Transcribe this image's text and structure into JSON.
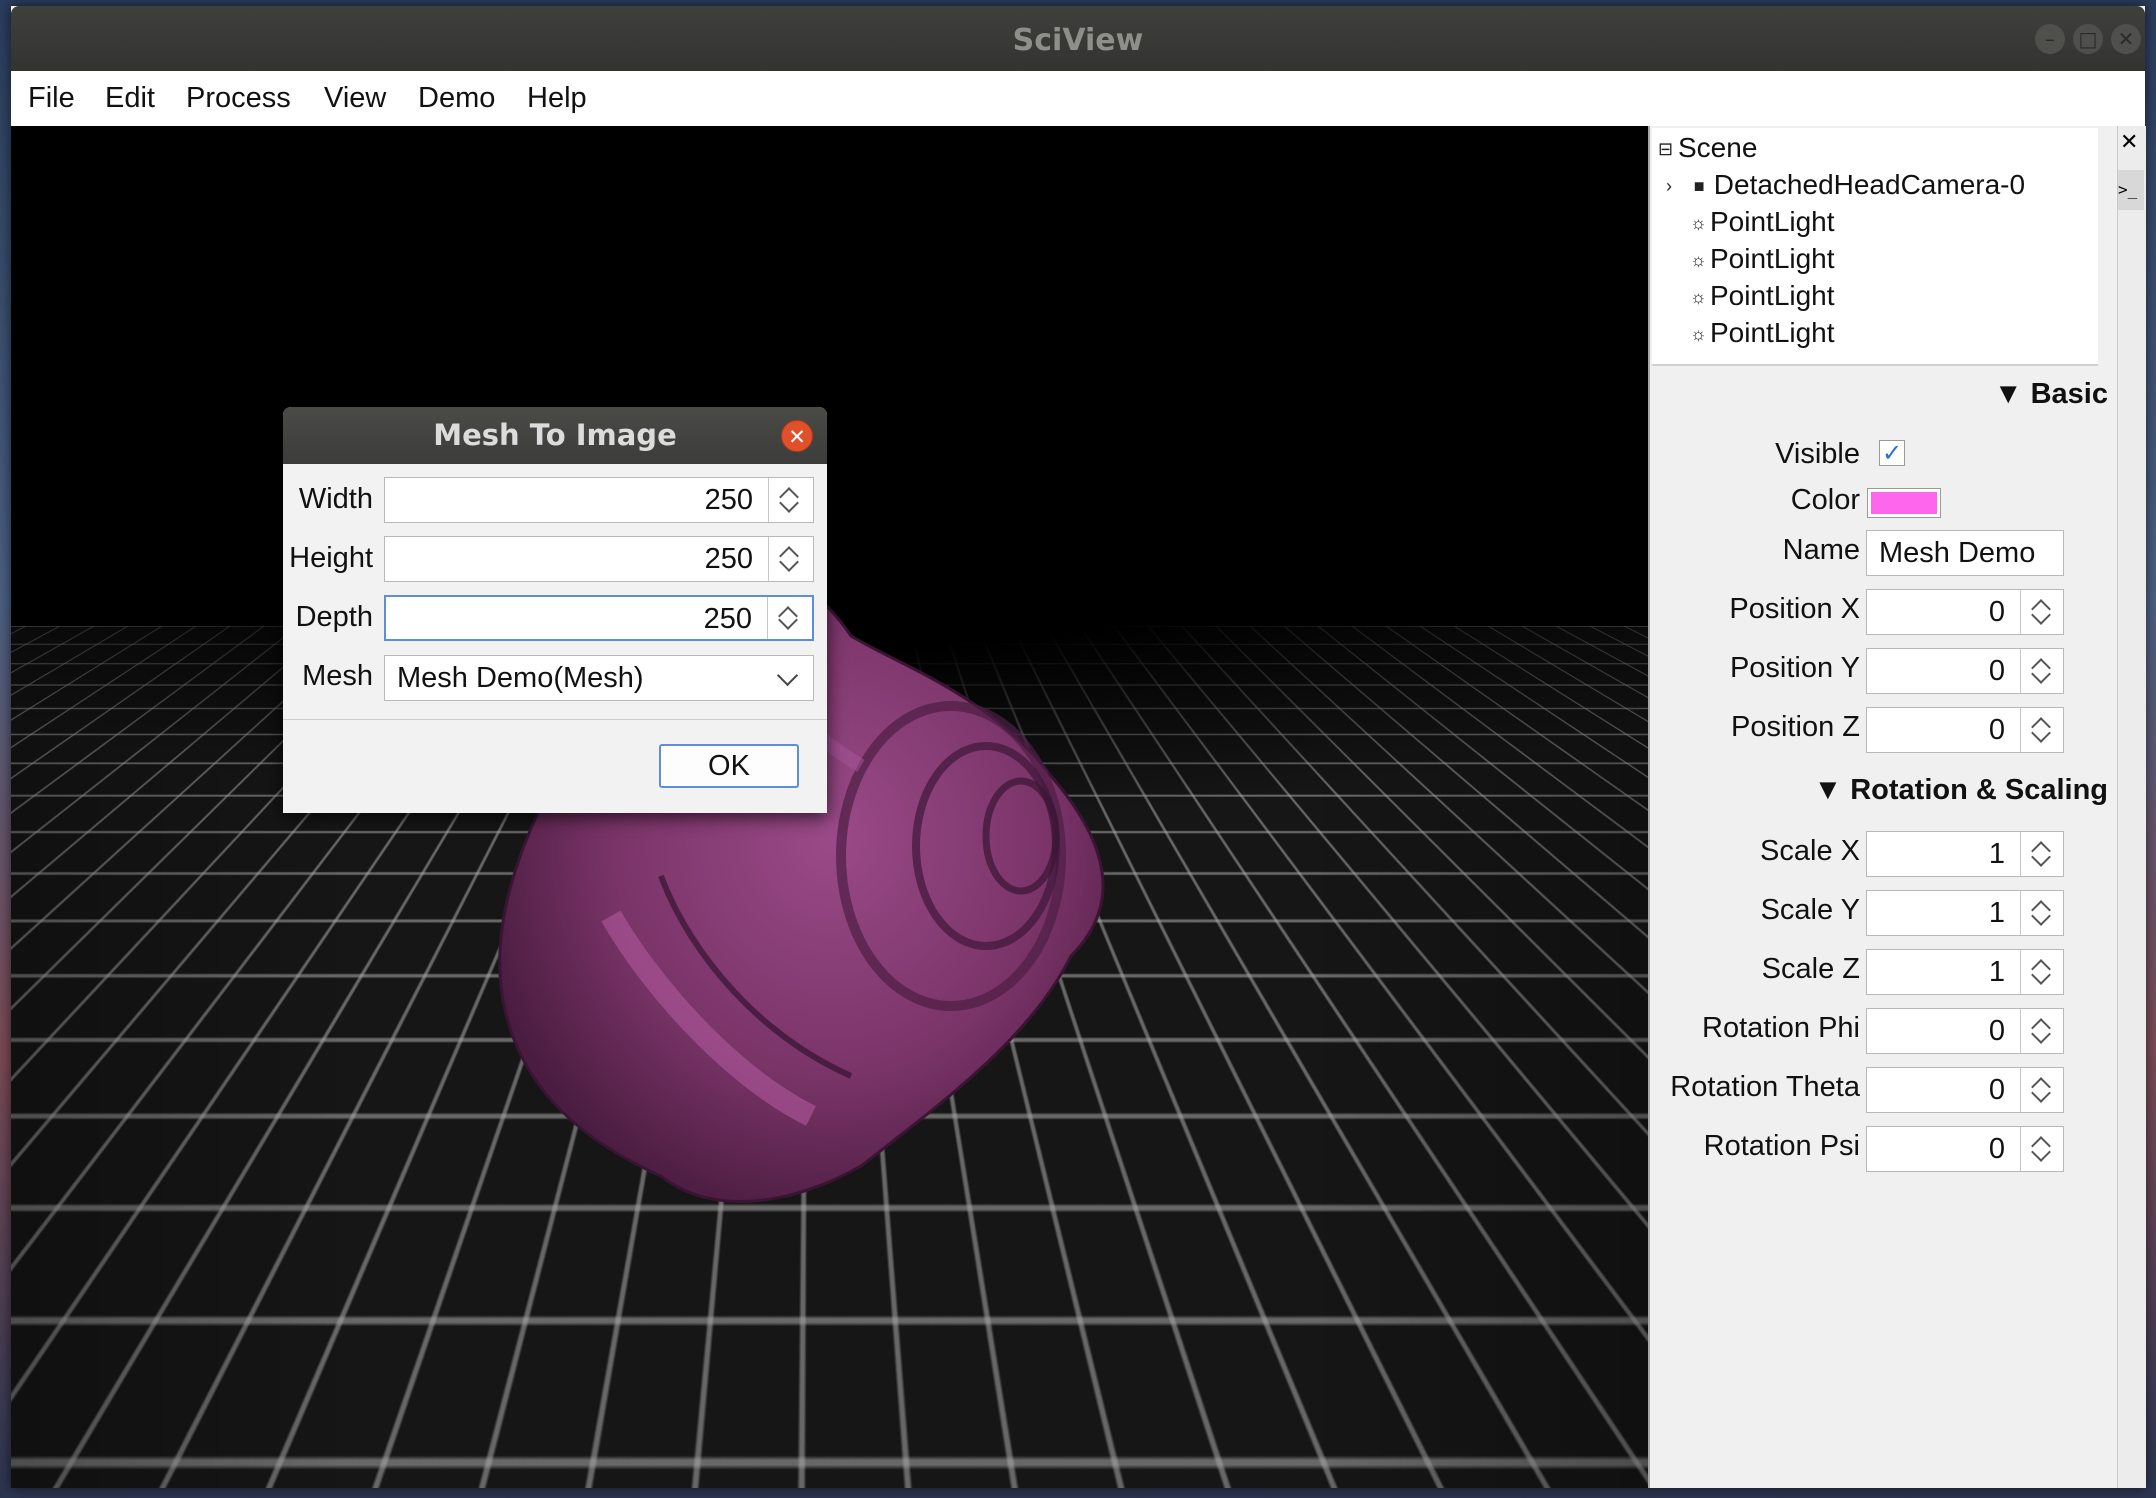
{
  "window": {
    "title": "SciView",
    "controls": [
      "minimize",
      "maximize",
      "close"
    ]
  },
  "menubar": {
    "items": [
      "File",
      "Edit",
      "Process",
      "View",
      "Demo",
      "Help"
    ]
  },
  "viewport": {
    "mesh_color": "#8a3f78",
    "background": "#000000"
  },
  "dialog": {
    "title": "Mesh To Image",
    "fields": [
      {
        "label": "Width",
        "value": "250"
      },
      {
        "label": "Height",
        "value": "250"
      },
      {
        "label": "Depth",
        "value": "250"
      }
    ],
    "mesh": {
      "label": "Mesh",
      "selected": "Mesh Demo(Mesh)"
    },
    "ok_label": "OK"
  },
  "scene_tree": {
    "root": "Scene",
    "items": [
      {
        "label": "DetachedHeadCamera-0",
        "icon": "camera-icon",
        "expandable": true
      },
      {
        "label": "PointLight",
        "icon": "light-icon"
      },
      {
        "label": "PointLight",
        "icon": "light-icon"
      },
      {
        "label": "PointLight",
        "icon": "light-icon"
      },
      {
        "label": "PointLight",
        "icon": "light-icon"
      }
    ]
  },
  "inspector": {
    "basic": {
      "header": "▼ Basic",
      "visible_label": "Visible",
      "visible": true,
      "color_label": "Color",
      "color": "#ff66ee",
      "name_label": "Name",
      "name": "Mesh Demo",
      "positions": [
        {
          "label": "Position X",
          "value": "0"
        },
        {
          "label": "Position Y",
          "value": "0"
        },
        {
          "label": "Position Z",
          "value": "0"
        }
      ]
    },
    "rotation_scaling": {
      "header": "▼ Rotation & Scaling",
      "fields": [
        {
          "label": "Scale X",
          "value": "1"
        },
        {
          "label": "Scale Y",
          "value": "1"
        },
        {
          "label": "Scale Z",
          "value": "1"
        },
        {
          "label": "Rotation Phi",
          "value": "0"
        },
        {
          "label": "Rotation Theta",
          "value": "0"
        },
        {
          "label": "Rotation Psi",
          "value": "0"
        }
      ]
    }
  },
  "side_strip": {
    "close_glyph": "✕",
    "console_glyph": ">_"
  }
}
